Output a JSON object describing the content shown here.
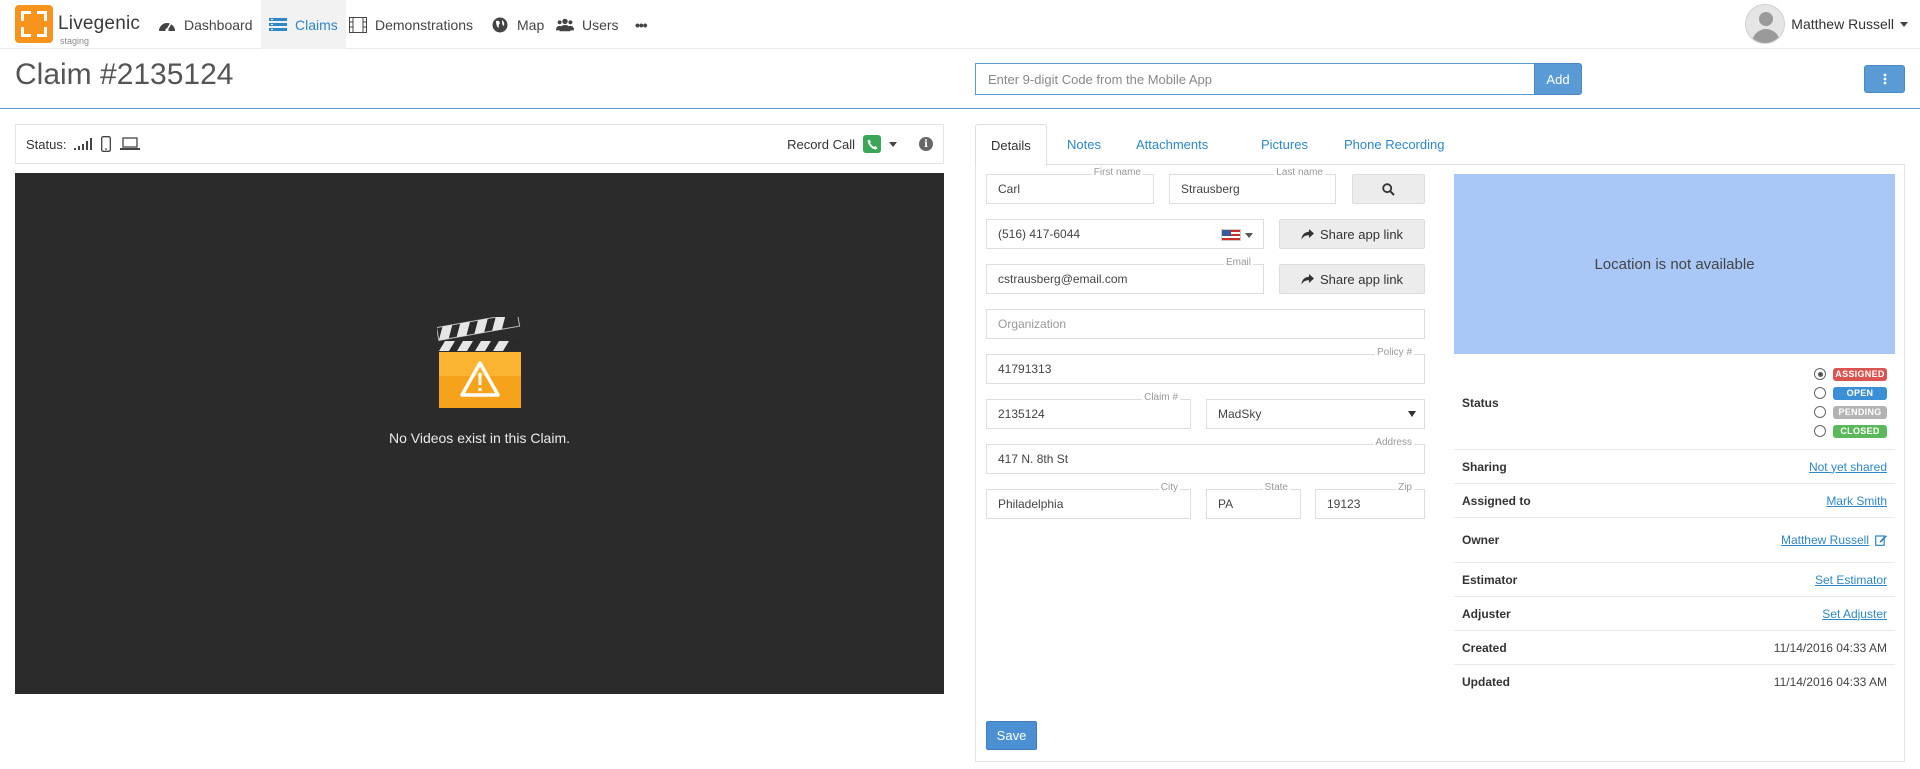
{
  "app": {
    "brand": "Livegenic",
    "env": "staging"
  },
  "nav": {
    "items": [
      {
        "label": "Dashboard",
        "icon": "dashboard-icon"
      },
      {
        "label": "Claims",
        "icon": "claims-icon",
        "active": true
      },
      {
        "label": "Demonstrations",
        "icon": "film-icon"
      },
      {
        "label": "Map",
        "icon": "globe-icon"
      },
      {
        "label": "Users",
        "icon": "users-icon"
      },
      {
        "label": "•••",
        "icon": "more-icon"
      }
    ]
  },
  "user": {
    "name": "Matthew Russell"
  },
  "header": {
    "title": "Claim #2135124",
    "code_placeholder": "Enter 9-digit Code from the Mobile App",
    "add_label": "Add"
  },
  "video_panel": {
    "status_label": "Status:",
    "record_call_label": "Record Call",
    "empty_message": "No Videos exist in this Claim."
  },
  "tabs": [
    "Details",
    "Notes",
    "Attachments",
    "Pictures",
    "Phone Recording"
  ],
  "form": {
    "first_name": {
      "label": "First name",
      "value": "Carl"
    },
    "last_name": {
      "label": "Last name",
      "value": "Strausberg"
    },
    "phone": {
      "value": "(516) 417-6044"
    },
    "share_app_link": "Share app link",
    "email": {
      "label": "Email",
      "value": "cstrausberg@email.com"
    },
    "organization": {
      "placeholder": "Organization"
    },
    "policy": {
      "label": "Policy #",
      "value": "41791313"
    },
    "claim": {
      "label": "Claim #",
      "value": "2135124"
    },
    "carrier": {
      "value": "MadSky"
    },
    "address": {
      "label": "Address",
      "value": "417 N. 8th St"
    },
    "city": {
      "label": "City",
      "value": "Philadelphia"
    },
    "state": {
      "label": "State",
      "value": "PA"
    },
    "zip": {
      "label": "Zip",
      "value": "19123"
    },
    "save_label": "Save"
  },
  "location": {
    "message": "Location is not available"
  },
  "info": {
    "status_label": "Status",
    "status_options": [
      {
        "label": "ASSIGNED",
        "color": "#d9534f",
        "selected": true
      },
      {
        "label": "OPEN",
        "color": "#3a8fd6",
        "selected": false
      },
      {
        "label": "PENDING",
        "color": "#b3b3b3",
        "selected": false
      },
      {
        "label": "CLOSED",
        "color": "#5cb85c",
        "selected": false
      }
    ],
    "sharing": {
      "label": "Sharing",
      "value": "Not yet shared"
    },
    "assigned_to": {
      "label": "Assigned to",
      "value": "Mark Smith"
    },
    "owner": {
      "label": "Owner",
      "value": "Matthew Russell"
    },
    "estimator": {
      "label": "Estimator",
      "value": "Set Estimator"
    },
    "adjuster": {
      "label": "Adjuster",
      "value": "Set Adjuster"
    },
    "created": {
      "label": "Created",
      "value": "11/14/2016 04:33 AM"
    },
    "updated": {
      "label": "Updated",
      "value": "11/14/2016 04:33 AM"
    }
  },
  "colors": {
    "accent": "#5b9bd5",
    "brand_orange": "#f7941d",
    "video_bg": "#2b2b2b",
    "map_bg": "#a9c8f8"
  }
}
